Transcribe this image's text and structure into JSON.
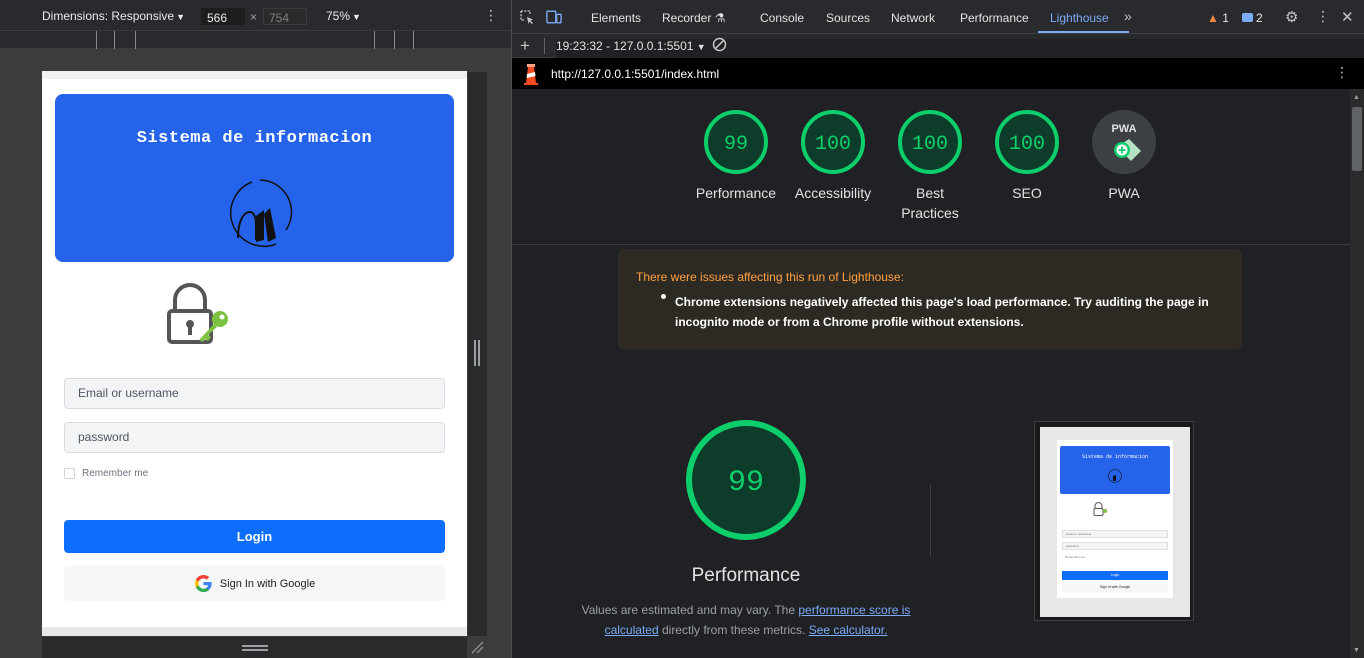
{
  "device_toolbar": {
    "dimensions_label": "Dimensions: Responsive",
    "width": "566",
    "height": "754",
    "zoom": "75%"
  },
  "emulated_page": {
    "header_title": "Sistema de informacion",
    "email_placeholder": "Email or username",
    "password_placeholder": "password",
    "remember_label": "Remember me",
    "login_label": "Login",
    "google_label": "Sign In with Google",
    "colors": {
      "header": "#2563eb",
      "login": "#0d6efd"
    }
  },
  "devtools": {
    "tabs": [
      "Elements",
      "Recorder",
      "Console",
      "Sources",
      "Network",
      "Performance",
      "Lighthouse"
    ],
    "active_tab": "Lighthouse",
    "warnings_count": "1",
    "messages_count": "2",
    "report_selector": "19:23:32 - 127.0.0.1:5501",
    "url": "http://127.0.0.1:5501/index.html"
  },
  "lighthouse": {
    "scores": [
      {
        "label": "Performance",
        "value": "99"
      },
      {
        "label": "Accessibility",
        "value": "100"
      },
      {
        "label": "Best Practices",
        "value": "100"
      },
      {
        "label": "SEO",
        "value": "100"
      }
    ],
    "pwa_label": "PWA",
    "pwa_badge": "PWA",
    "warning_title": "There were issues affecting this run of Lighthouse:",
    "warning_item": "Chrome extensions negatively affected this page's load performance. Try auditing the page in incognito mode or from a Chrome profile without extensions.",
    "big_score": "99",
    "big_title": "Performance",
    "desc_prefix": "Values are estimated and may vary. The ",
    "desc_link1": "performance score is calculated",
    "desc_middle": " directly from these metrics. ",
    "desc_link2": "See calculator.",
    "colors": {
      "pass": "#0cce6b",
      "pass_bg": "#0d3d2a",
      "warning_text": "#ffa040"
    }
  },
  "thumbnail": {
    "title": "Sistema de informacion",
    "email": "Email or username",
    "password": "password",
    "remember": "Remember me",
    "login": "Login",
    "google": "Sign In with Google"
  }
}
